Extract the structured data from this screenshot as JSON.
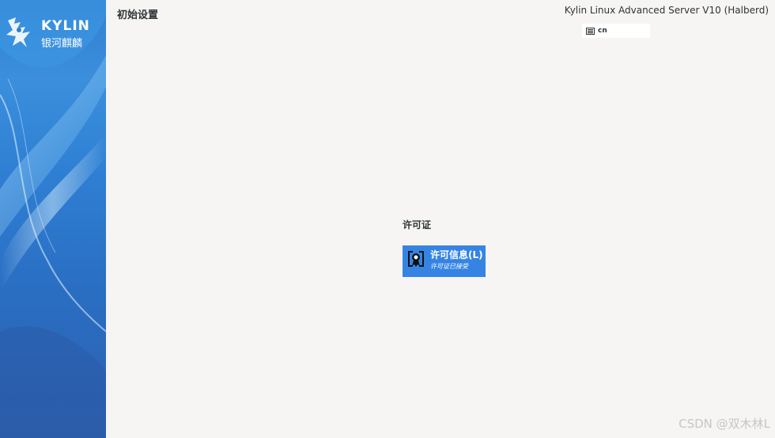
{
  "sidebar": {
    "logo_en": "KYLIN",
    "logo_cn": "银河麒麟"
  },
  "header": {
    "title": "初始设置",
    "product": "Kylin Linux Advanced Server V10 (Halberd)",
    "keyboard_layout": "cn"
  },
  "main": {
    "section_title": "许可证",
    "spokes": [
      {
        "label": "许可信息(L)",
        "status": "许可证已接受",
        "icon": "license-icon"
      }
    ]
  },
  "watermark": "CSDN @双木林L",
  "colors": {
    "accent": "#3584e4",
    "background": "#f6f5f3",
    "sidebar": "#2f7fd0"
  }
}
